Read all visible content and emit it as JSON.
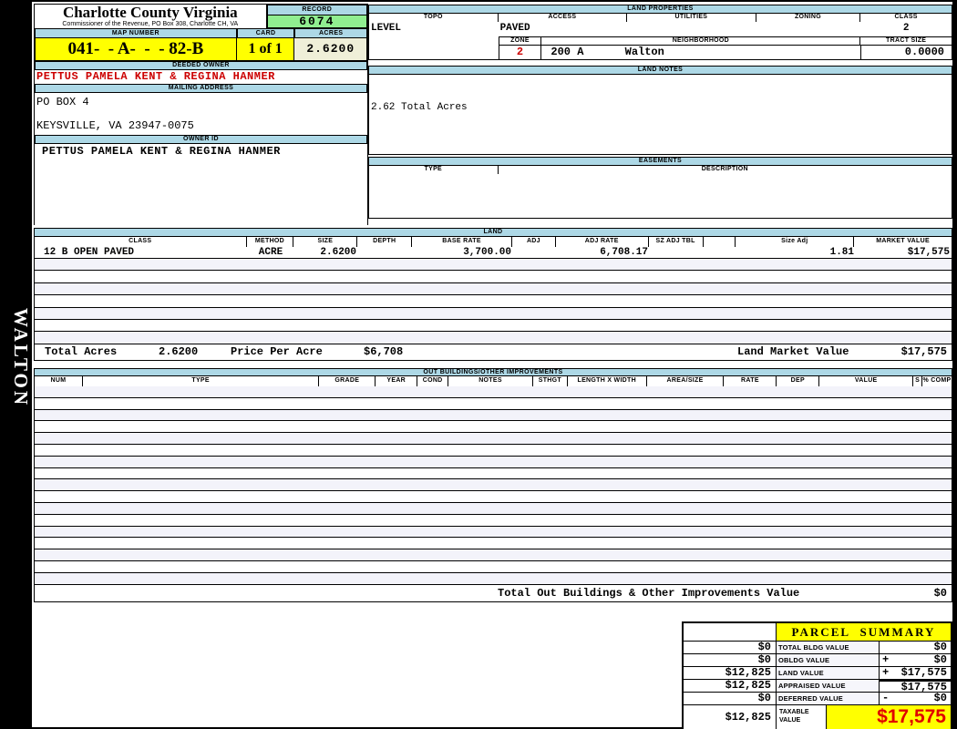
{
  "sidebar": {
    "district": "WALTON"
  },
  "header": {
    "county_title": "Charlotte County Virginia",
    "county_subtitle": "Commissioner of the Revenue, PO Box 308, Charlotte CH, VA",
    "record_label": "RECORD",
    "record_number": "6074",
    "map_number_label": "MAP NUMBER",
    "map_number": "041-  - A-  -  - 82-B",
    "card_label": "CARD",
    "card": "1 of 1",
    "acres_label": "ACRES",
    "acres": "2.6200"
  },
  "owner": {
    "deeded_owner_label": "DEEDED OWNER",
    "deeded_owner": "PETTUS PAMELA KENT & REGINA HANMER",
    "mailing_address_label": "MAILING ADDRESS",
    "address_line1": "PO BOX 4",
    "address_line2": "KEYSVILLE, VA 23947-0075",
    "owner_id_label": "OWNER ID",
    "owner_id": "PETTUS PAMELA KENT & REGINA HANMER"
  },
  "land_properties": {
    "title": "LAND PROPERTIES",
    "topo_label": "TOPO",
    "access_label": "ACCESS",
    "utilities_label": "UTILITIES",
    "zoning_label": "ZONING",
    "class_label": "CLASS",
    "topo": "LEVEL",
    "access": "PAVED",
    "utilities": "",
    "zoning": "",
    "class": "2",
    "zone_label": "ZONE",
    "zone": "2",
    "neighborhood_label": "NEIGHBORHOOD",
    "neighborhood_code": "200 A",
    "neighborhood_name": "Walton",
    "tract_size_label": "TRACT SIZE",
    "tract_size": "0.0000"
  },
  "land_notes": {
    "title": "LAND NOTES",
    "note": "2.62 Total Acres"
  },
  "easements": {
    "title": "EASEMENTS",
    "type_label": "TYPE",
    "description_label": "DESCRIPTION"
  },
  "land": {
    "title": "LAND",
    "columns": [
      "CLASS",
      "METHOD",
      "SIZE",
      "DEPTH",
      "BASE RATE",
      "ADJ",
      "ADJ RATE",
      "SZ ADJ TBL",
      "",
      "Size Adj",
      "MARKET VALUE"
    ],
    "rows": [
      {
        "class": "12 B OPEN PAVED",
        "method": "ACRE",
        "size": "2.6200",
        "depth": "",
        "base_rate": "3,700.00",
        "adj": "",
        "adj_rate": "6,708.17",
        "sz_adj_tbl": "",
        "size_adj": "1.81",
        "market_value": "$17,575"
      }
    ],
    "totals": {
      "total_acres_label": "Total Acres",
      "total_acres": "2.6200",
      "price_per_acre_label": "Price Per Acre",
      "price_per_acre": "$6,708",
      "land_market_value_label": "Land Market Value",
      "land_market_value": "$17,575"
    }
  },
  "out_buildings": {
    "title": "OUT BUILDINGS/OTHER IMPROVEMENTS",
    "columns": [
      "NUM",
      "TYPE",
      "GRADE",
      "YEAR",
      "COND",
      "NOTES",
      "STHGT",
      "LENGTH X WIDTH",
      "AREA/SIZE",
      "RATE",
      "DEP",
      "VALUE",
      "S",
      "% COMP"
    ],
    "total_label": "Total Out Buildings & Other Improvements Value",
    "total_value": "$0"
  },
  "parcel_summary": {
    "title": "PARCEL SUMMARY",
    "rows": [
      {
        "prior": "$0",
        "label": "TOTAL BLDG VALUE",
        "op": "",
        "value": "$0"
      },
      {
        "prior": "$0",
        "label": "OBLDG VALUE",
        "op": "+",
        "value": "$0"
      },
      {
        "prior": "$12,825",
        "label": "LAND VALUE",
        "op": "+",
        "value": "$17,575"
      },
      {
        "prior": "$12,825",
        "label": "APPRAISED VALUE",
        "op": "",
        "value": "$17,575"
      },
      {
        "prior": "$0",
        "label": "DEFERRED VALUE",
        "op": "-",
        "value": "$0"
      }
    ],
    "taxable": {
      "prior": "$12,825",
      "label": "TAXABLE VALUE",
      "value": "$17,575"
    }
  },
  "colors": {
    "band_blue": "#ADD8E6",
    "record_green": "#90EE90",
    "highlight_yellow": "#FFFF00",
    "acres_cream": "#EFEFD8",
    "alt_row": "#F3F3FA",
    "owner_red": "#CC0000",
    "taxable_red": "#E00000"
  }
}
